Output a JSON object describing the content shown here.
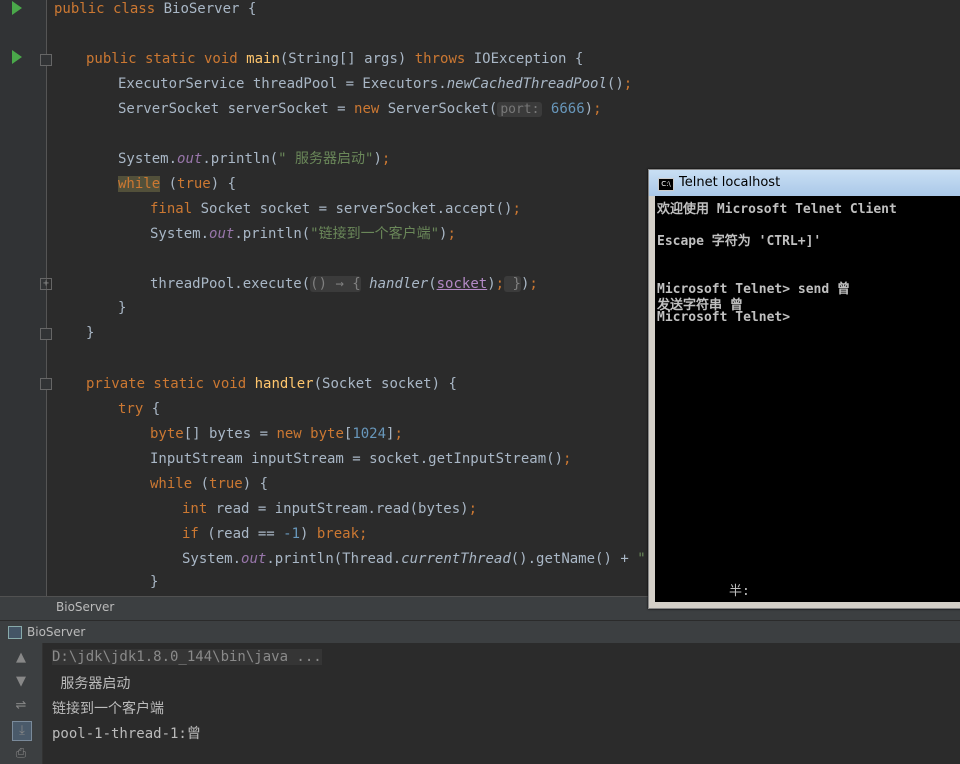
{
  "editor": {
    "tab_label": "BioServer",
    "lines": {
      "l1_kw": "public class",
      "l1_rest": " BioServer {",
      "main_mod": "public static void",
      "main_name": "main",
      "main_args": "(String[] args) ",
      "main_throws": "throws",
      "main_exc": " IOException {",
      "pool_a": "ExecutorService threadPool = Executors.",
      "pool_b": "newCachedThreadPool",
      "pool_c": "()",
      "pool_sc": ";",
      "ss_a": "ServerSocket serverSocket = ",
      "ss_new": "new",
      "ss_b": " ServerSocket(",
      "ss_hint": "port:",
      "ss_num": "6666",
      "ss_c": ")",
      "ss_sc": ";",
      "p1_a": "System.",
      "p1_out": "out",
      "p1_b": ".println(",
      "p1_str": "\" 服务器启动\"",
      "p1_c": ")",
      "p1_sc": ";",
      "while1": "while",
      "while1_b": " (",
      "while1_true": "true",
      "while1_c": ") {",
      "final_kw": "final",
      "final_rest": " Socket socket = serverSocket.accept()",
      "final_sc": ";",
      "p2_a": "System.",
      "p2_out": "out",
      "p2_b": ".println(",
      "p2_str": "\"链接到一个客户端\"",
      "p2_c": ")",
      "p2_sc": ";",
      "exec_a": "threadPool.execute(",
      "exec_lam": "() → {",
      "exec_handler": "handler",
      "exec_p": "(",
      "exec_sock": "socket",
      "exec_p2": ")",
      "exec_sc": ";",
      "exec_close": " }",
      "exec_end": ")",
      "exec_sc2": ";",
      "brace1": "}",
      "brace2": "}",
      "h_mod": "private static void",
      "h_name": "handler",
      "h_args": "(Socket socket) {",
      "try_kw": "try",
      "try_b": " {",
      "byte_kw": "byte",
      "byte_a": "[] bytes = ",
      "byte_new": "new",
      "byte_kw2": "byte",
      "byte_b": "[",
      "byte_num": "1024",
      "byte_c": "]",
      "byte_sc": ";",
      "is_a": "InputStream inputStream = socket.getInputStream()",
      "is_sc": ";",
      "while2": "while",
      "while2_b": " (",
      "while2_true": "true",
      "while2_c": ") {",
      "int_kw": "int",
      "int_rest": " read = inputStream.read(bytes)",
      "int_sc": ";",
      "if_kw": "if",
      "if_a": " (read == ",
      "if_num": "-1",
      "if_b": ") ",
      "if_break": "break",
      "if_sc": ";",
      "p3_a": "System.",
      "p3_out": "out",
      "p3_b": ".println(Thread.",
      "p3_ct": "currentThread",
      "p3_c": "().getName() + ",
      "p3_str": "\":\"",
      "p3_d": " +",
      "brace3": "}"
    }
  },
  "run_panel": {
    "title": "BioServer"
  },
  "console": {
    "cmd": "D:\\jdk\\jdk1.8.0_144\\bin\\java ...",
    "out1": " 服务器启动",
    "out2": "链接到一个客户端",
    "out3": "pool-1-thread-1:曾"
  },
  "telnet": {
    "title": "Telnet localhost",
    "icon_text": "C:\\",
    "lines": [
      "欢迎使用 Microsoft Telnet Client",
      "Escape 字符为 'CTRL+]'",
      "Microsoft Telnet> send 曾",
      "发送字符串 曾",
      "Microsoft Telnet>"
    ],
    "ime": "半:"
  },
  "colors": {
    "keyword": "#cc7832",
    "function": "#ffc66d",
    "string": "#6a8759",
    "number": "#6897bb",
    "field": "#9876aa",
    "run_arrow": "#4aa84a"
  }
}
